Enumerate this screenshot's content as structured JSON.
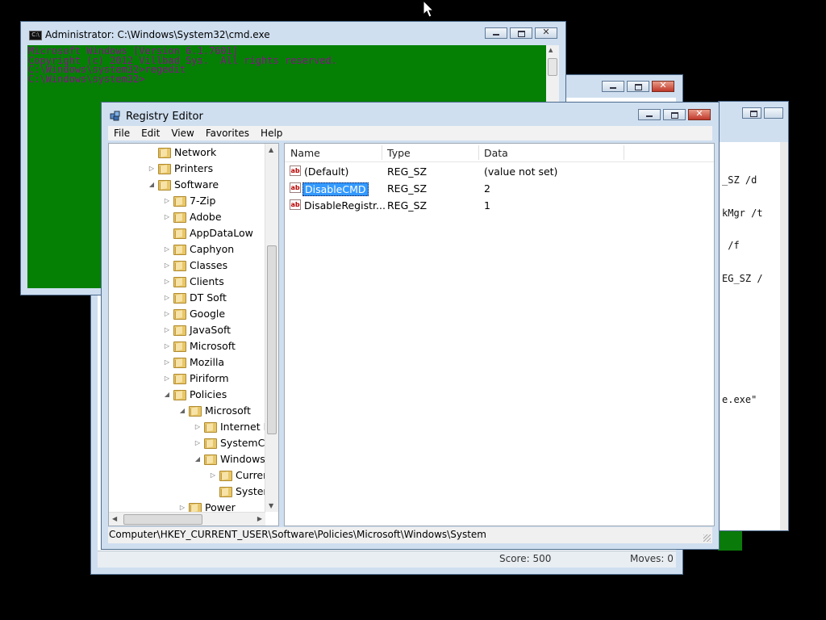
{
  "back_window": {
    "score": "Score: 500",
    "moves": "Moves: 0"
  },
  "right_window": {
    "lines": [
      "_SZ /d",
      "kMgr /t",
      " /f",
      "EG_SZ /"
    ],
    "exe_line": "e.exe\""
  },
  "cmd_window": {
    "title": "Administrator: C:\\Windows\\System32\\cmd.exe",
    "lines": [
      "Microsoft Windows [Version 6.1.7601]",
      "Copyright (c) 2012 Villbad Sys.  All rights reserved.",
      "",
      "C:\\Windows\\system32>regedit",
      "",
      "C:\\Windows\\system32>"
    ],
    "colors": {
      "background": "#058005",
      "text": "#88108a"
    }
  },
  "regedit": {
    "title": "Registry Editor",
    "menu": [
      "File",
      "Edit",
      "View",
      "Favorites",
      "Help"
    ],
    "tree": [
      {
        "label": "Network",
        "level": 1,
        "expander": "none"
      },
      {
        "label": "Printers",
        "level": 1,
        "expander": "collapsed"
      },
      {
        "label": "Software",
        "level": 1,
        "expander": "expanded"
      },
      {
        "label": "7-Zip",
        "level": 2,
        "expander": "collapsed"
      },
      {
        "label": "Adobe",
        "level": 2,
        "expander": "collapsed"
      },
      {
        "label": "AppDataLow",
        "level": 2,
        "expander": "none"
      },
      {
        "label": "Caphyon",
        "level": 2,
        "expander": "collapsed"
      },
      {
        "label": "Classes",
        "level": 2,
        "expander": "collapsed"
      },
      {
        "label": "Clients",
        "level": 2,
        "expander": "collapsed"
      },
      {
        "label": "DT Soft",
        "level": 2,
        "expander": "collapsed"
      },
      {
        "label": "Google",
        "level": 2,
        "expander": "collapsed"
      },
      {
        "label": "JavaSoft",
        "level": 2,
        "expander": "collapsed"
      },
      {
        "label": "Microsoft",
        "level": 2,
        "expander": "collapsed"
      },
      {
        "label": "Mozilla",
        "level": 2,
        "expander": "collapsed"
      },
      {
        "label": "Piriform",
        "level": 2,
        "expander": "collapsed"
      },
      {
        "label": "Policies",
        "level": 2,
        "expander": "expanded"
      },
      {
        "label": "Microsoft",
        "level": 3,
        "expander": "expanded"
      },
      {
        "label": "Internet E",
        "level": 4,
        "expander": "collapsed"
      },
      {
        "label": "SystemCe",
        "level": 4,
        "expander": "collapsed"
      },
      {
        "label": "Windows",
        "level": 4,
        "expander": "expanded"
      },
      {
        "label": "Curren",
        "level": 5,
        "expander": "collapsed"
      },
      {
        "label": "System",
        "level": 5,
        "expander": "none"
      },
      {
        "label": "Power",
        "level": 3,
        "expander": "collapsed"
      }
    ],
    "columns": [
      "Name",
      "Type",
      "Data"
    ],
    "values": [
      {
        "name": "(Default)",
        "type": "REG_SZ",
        "data": "(value not set)",
        "selected": false
      },
      {
        "name": "DisableCMD",
        "type": "REG_SZ",
        "data": "2",
        "selected": true
      },
      {
        "name": "DisableRegistr...",
        "type": "REG_SZ",
        "data": "1",
        "selected": false
      }
    ],
    "value_icon_text": "ab",
    "status_path": "Computer\\HKEY_CURRENT_USER\\Software\\Policies\\Microsoft\\Windows\\System"
  }
}
